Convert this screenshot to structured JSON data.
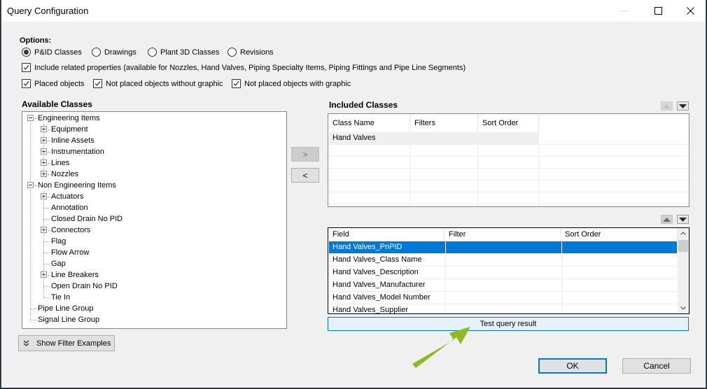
{
  "window": {
    "title": "Query Configuration",
    "controls": {
      "minimize": "minimize-icon",
      "maximize": "maximize-icon",
      "close": "close-icon"
    }
  },
  "options": {
    "heading": "Options:",
    "radios": [
      {
        "label": "P&ID Classes",
        "selected": true
      },
      {
        "label": "Drawings",
        "selected": false
      },
      {
        "label": "Plant 3D Classes",
        "selected": false
      },
      {
        "label": "Revisions",
        "selected": false
      }
    ],
    "include_related": {
      "label": "Include related properties (available for Nozzles, Hand Valves, Piping Specialty Items, Piping Fittings and Pipe Line Segments)",
      "checked": true
    },
    "checkboxes": [
      {
        "label": "Placed objects",
        "checked": true
      },
      {
        "label": "Not placed objects without graphic",
        "checked": true
      },
      {
        "label": "Not placed objects with graphic",
        "checked": true
      }
    ]
  },
  "available": {
    "heading": "Available Classes",
    "tree": [
      {
        "label": "Engineering Items",
        "level": 0,
        "expander": "minus"
      },
      {
        "label": "Equipment",
        "level": 1,
        "expander": "plus"
      },
      {
        "label": "Inline Assets",
        "level": 1,
        "expander": "plus"
      },
      {
        "label": "Instrumentation",
        "level": 1,
        "expander": "plus"
      },
      {
        "label": "Lines",
        "level": 1,
        "expander": "plus"
      },
      {
        "label": "Nozzles",
        "level": 1,
        "expander": "plus"
      },
      {
        "label": "Non Engineering Items",
        "level": 0,
        "expander": "minus"
      },
      {
        "label": "Actuators",
        "level": 1,
        "expander": "plus"
      },
      {
        "label": "Annotation",
        "level": 1,
        "expander": "none"
      },
      {
        "label": "Closed Drain No PID",
        "level": 1,
        "expander": "none"
      },
      {
        "label": "Connectors",
        "level": 1,
        "expander": "plus"
      },
      {
        "label": "Flag",
        "level": 1,
        "expander": "none"
      },
      {
        "label": "Flow Arrow",
        "level": 1,
        "expander": "none"
      },
      {
        "label": "Gap",
        "level": 1,
        "expander": "none"
      },
      {
        "label": "Line Breakers",
        "level": 1,
        "expander": "plus"
      },
      {
        "label": "Open Drain No PID",
        "level": 1,
        "expander": "none"
      },
      {
        "label": "Tie In",
        "level": 1,
        "expander": "none"
      },
      {
        "label": "Pipe Line Group",
        "level": 0,
        "expander": "none"
      },
      {
        "label": "Signal Line Group",
        "level": 0,
        "expander": "none"
      }
    ],
    "show_filter_examples": "Show Filter Examples"
  },
  "transfer": {
    "add": ">",
    "remove": "<"
  },
  "included": {
    "heading": "Included Classes",
    "columns": [
      "Class Name",
      "Filters",
      "Sort Order"
    ],
    "rows": [
      [
        "Hand Valves",
        "",
        ""
      ]
    ]
  },
  "fields": {
    "columns": [
      "Field",
      "Filter",
      "Sort Order"
    ],
    "rows": [
      [
        "Hand Valves_PnPID",
        "",
        ""
      ],
      [
        "Hand Valves_Class Name",
        "",
        ""
      ],
      [
        "Hand Valves_Description",
        "",
        ""
      ],
      [
        "Hand Valves_Manufacturer",
        "",
        ""
      ],
      [
        "Hand Valves_Model Number",
        "",
        ""
      ],
      [
        "Hand Valves_Supplier",
        "",
        ""
      ]
    ],
    "selected_index": 0
  },
  "test_query": "Test query result",
  "footer": {
    "ok": "OK",
    "cancel": "Cancel"
  },
  "colors": {
    "accent": "#0078d7",
    "annotation_arrow": "#8dbb22",
    "selection": "#0078d7"
  }
}
